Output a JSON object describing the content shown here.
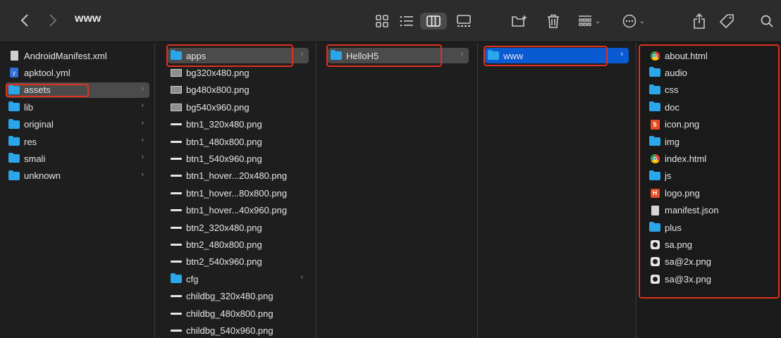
{
  "window": {
    "title": "www",
    "back_icon": "chevron-left-icon",
    "forward_icon": "chevron-right-icon"
  },
  "toolbar": {
    "icons": [
      "grid-view-icon",
      "list-view-icon",
      "column-view-icon",
      "gallery-view-icon",
      "new-folder-icon",
      "trash-icon",
      "group-icon",
      "more-icon",
      "share-icon",
      "tag-icon",
      "search-icon"
    ]
  },
  "colors": {
    "selection_gray": "#4b4b4b",
    "selection_blue": "#0a5bd3",
    "folder": "#2aa7ea",
    "highlight": "#e0301e"
  },
  "columns": [
    {
      "items": [
        {
          "label": "AndroidManifest.xml",
          "icon": "document-icon"
        },
        {
          "label": "apktool.yml",
          "icon": "yml-file-icon"
        },
        {
          "label": "assets",
          "icon": "folder-icon",
          "selected": true
        },
        {
          "label": "lib",
          "icon": "folder-icon"
        },
        {
          "label": "original",
          "icon": "folder-icon"
        },
        {
          "label": "res",
          "icon": "folder-icon"
        },
        {
          "label": "smali",
          "icon": "folder-icon"
        },
        {
          "label": "unknown",
          "icon": "folder-icon"
        }
      ]
    },
    {
      "items": [
        {
          "label": "apps",
          "icon": "folder-icon",
          "selected": true
        },
        {
          "label": "bg320x480.png",
          "icon": "image-icon"
        },
        {
          "label": "bg480x800.png",
          "icon": "image-icon"
        },
        {
          "label": "bg540x960.png",
          "icon": "image-icon"
        },
        {
          "label": "btn1_320x480.png",
          "icon": "image-icon"
        },
        {
          "label": "btn1_480x800.png",
          "icon": "image-icon"
        },
        {
          "label": "btn1_540x960.png",
          "icon": "image-icon"
        },
        {
          "label": "btn1_hover...20x480.png",
          "icon": "image-icon"
        },
        {
          "label": "btn1_hover...80x800.png",
          "icon": "image-icon"
        },
        {
          "label": "btn1_hover...40x960.png",
          "icon": "image-icon"
        },
        {
          "label": "btn2_320x480.png",
          "icon": "image-icon"
        },
        {
          "label": "btn2_480x800.png",
          "icon": "image-icon"
        },
        {
          "label": "btn2_540x960.png",
          "icon": "image-icon"
        },
        {
          "label": "cfg",
          "icon": "folder-icon"
        },
        {
          "label": "childbg_320x480.png",
          "icon": "image-icon"
        },
        {
          "label": "childbg_480x800.png",
          "icon": "image-icon"
        },
        {
          "label": "childbg_540x960.png",
          "icon": "image-icon"
        }
      ]
    },
    {
      "items": [
        {
          "label": "HelloH5",
          "icon": "folder-icon",
          "selected": true
        }
      ]
    },
    {
      "items": [
        {
          "label": "www",
          "icon": "folder-icon",
          "selected": true
        }
      ]
    },
    {
      "items": [
        {
          "label": "about.html",
          "icon": "chrome-html-icon"
        },
        {
          "label": "audio",
          "icon": "folder-icon"
        },
        {
          "label": "css",
          "icon": "folder-icon"
        },
        {
          "label": "doc",
          "icon": "folder-icon"
        },
        {
          "label": "icon.png",
          "icon": "html5-image-icon"
        },
        {
          "label": "img",
          "icon": "folder-icon"
        },
        {
          "label": "index.html",
          "icon": "chrome-html-icon"
        },
        {
          "label": "js",
          "icon": "folder-icon"
        },
        {
          "label": "logo.png",
          "icon": "logo-image-icon"
        },
        {
          "label": "manifest.json",
          "icon": "json-file-icon"
        },
        {
          "label": "plus",
          "icon": "folder-icon"
        },
        {
          "label": "sa.png",
          "icon": "sa-image-icon"
        },
        {
          "label": "sa@2x.png",
          "icon": "sa-image-icon"
        },
        {
          "label": "sa@3x.png",
          "icon": "sa-image-icon"
        }
      ]
    }
  ]
}
